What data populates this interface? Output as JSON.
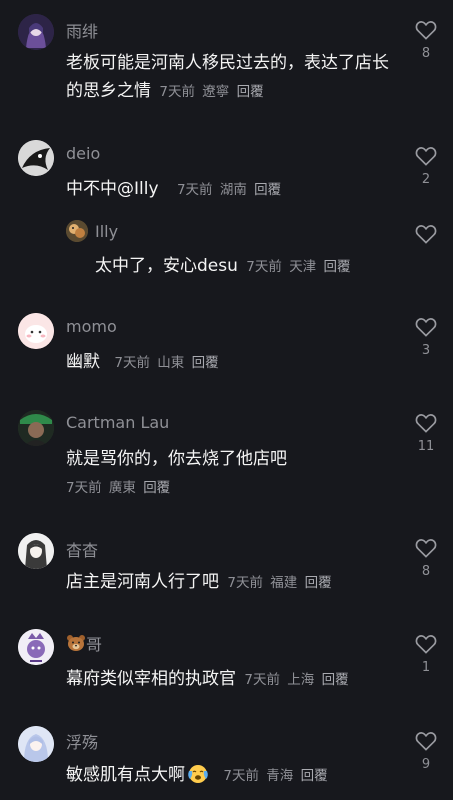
{
  "comments": [
    {
      "username": "雨绯",
      "text": "老板可能是河南人移民过去的，表达了店长的思乡之情",
      "time": "7天前",
      "location": "遼寧",
      "reply": "回覆",
      "likes": "8"
    },
    {
      "username": "deio",
      "text": "中不中@Illy",
      "time": "7天前",
      "location": "湖南",
      "reply": "回覆",
      "likes": "2"
    },
    {
      "username": "Illy",
      "text": "太中了，安心desu",
      "time": "7天前",
      "location": "天津",
      "reply": "回覆",
      "likes": ""
    },
    {
      "username": "momo",
      "text": "幽默",
      "time": "7天前",
      "location": "山東",
      "reply": "回覆",
      "likes": "3"
    },
    {
      "username": "Cartman Lau",
      "text": "就是骂你的，你去烧了他店吧",
      "time": "7天前",
      "location": "廣東",
      "reply": "回覆",
      "likes": "11"
    },
    {
      "username": "杳杳",
      "text": "店主是河南人行了吧",
      "time": "7天前",
      "location": "福建",
      "reply": "回覆",
      "likes": "8"
    },
    {
      "username": "哥",
      "username_emoji": "bear-face-icon",
      "text": "幕府类似宰相的执政官",
      "time": "7天前",
      "location": "上海",
      "reply": "回覆",
      "likes": "1"
    },
    {
      "username": "浮殇",
      "text": "敏感肌有点大啊",
      "text_emoji": "crying-face-icon",
      "time": "7天前",
      "location": "青海",
      "reply": "回覆",
      "likes": "9"
    }
  ],
  "colors": {
    "background": "#17181d",
    "username": "#8f9096",
    "text": "#f4f4f4",
    "meta": "#8f9096"
  }
}
